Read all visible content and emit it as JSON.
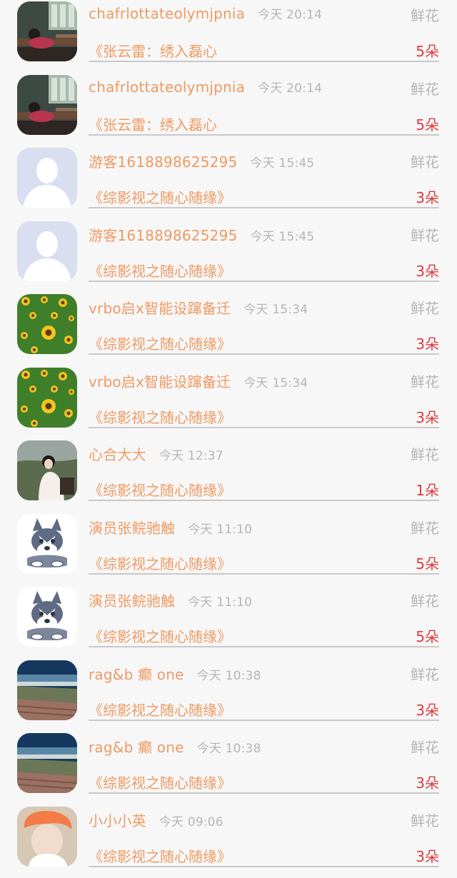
{
  "rows": [
    {
      "name": "chafrlottateolymjpnia",
      "time": "今天 20:14",
      "gift": "鲜花",
      "book": "《张云雷：绣入磊心",
      "count": "5朵",
      "avatar": "classroom-photo"
    },
    {
      "name": "chafrlottateolymjpnia",
      "time": "今天 20:14",
      "gift": "鲜花",
      "book": "《张云雷：绣入磊心",
      "count": "5朵",
      "avatar": "classroom-photo"
    },
    {
      "name": "游客1618898625295",
      "time": "今天 15:45",
      "gift": "鲜花",
      "book": "《综影视之随心随缘》",
      "count": "3朵",
      "avatar": "default-user"
    },
    {
      "name": "游客1618898625295",
      "time": "今天 15:45",
      "gift": "鲜花",
      "book": "《综影视之随心随缘》",
      "count": "3朵",
      "avatar": "default-user"
    },
    {
      "name": "vrbo启x智能设蹿备迁",
      "time": "今天 15:34",
      "gift": "鲜花",
      "book": "《综影视之随心随缘》",
      "count": "3朵",
      "avatar": "sunflowers"
    },
    {
      "name": "vrbo启x智能设蹿备迁",
      "time": "今天 15:34",
      "gift": "鲜花",
      "book": "《综影视之随心随缘》",
      "count": "3朵",
      "avatar": "sunflowers"
    },
    {
      "name": "心合大大",
      "time": "今天 12:37",
      "gift": "鲜花",
      "book": "《综影视之随心随缘》",
      "count": "1朵",
      "avatar": "girl-photo"
    },
    {
      "name": "演员张鲩驰触",
      "time": "今天 11:10",
      "gift": "鲜花",
      "book": "《综影视之随心随缘》",
      "count": "5朵",
      "avatar": "husky"
    },
    {
      "name": "演员张鲩驰触",
      "time": "今天 11:10",
      "gift": "鲜花",
      "book": "《综影视之随心随缘》",
      "count": "5朵",
      "avatar": "husky"
    },
    {
      "name": "rag&b 癫 one",
      "time": "今天 10:38",
      "gift": "鲜花",
      "book": "《综影视之随心随缘》",
      "count": "3朵",
      "avatar": "seaside"
    },
    {
      "name": "rag&b 癫 one",
      "time": "今天 10:38",
      "gift": "鲜花",
      "book": "《综影视之随心随缘》",
      "count": "3朵",
      "avatar": "seaside"
    },
    {
      "name": "小小小英",
      "time": "今天 09:06",
      "gift": "鲜花",
      "book": "《综影视之随心随缘》",
      "count": "3朵",
      "avatar": "orange-hair-photo"
    }
  ],
  "colors": {
    "accent": "#ef9a62",
    "count": "#e0393e",
    "muted": "#b5b5b5",
    "background": "#f7f7f7"
  }
}
